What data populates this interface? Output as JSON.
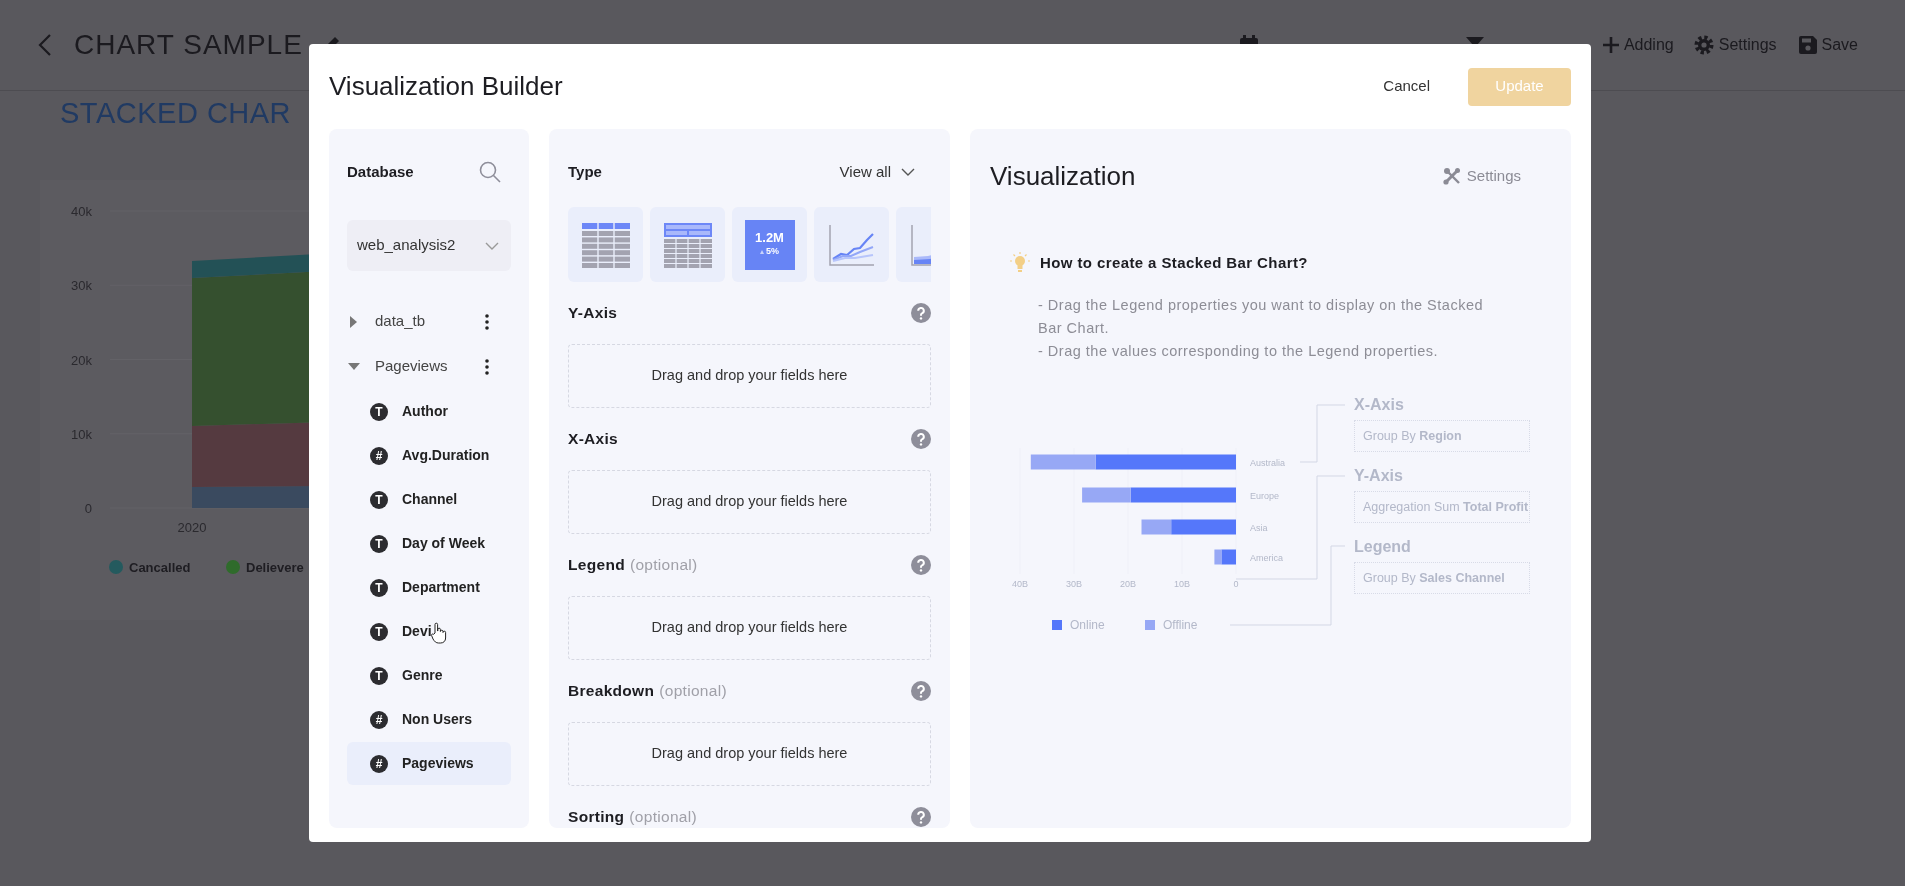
{
  "page": {
    "title": "CHART SAMPLE",
    "subtitle": "STACKED CHAR",
    "toolbar": [
      {
        "kind": "calendar"
      },
      {
        "kind": "filter"
      },
      {
        "kind": "add",
        "label": "Adding"
      },
      {
        "kind": "settings",
        "label": "Settings"
      },
      {
        "kind": "save",
        "label": "Save"
      }
    ],
    "chart": {
      "y_labels": [
        "40k",
        "30k",
        "20k",
        "10k",
        "0"
      ],
      "x_labels": [
        "2020"
      ],
      "legend": [
        {
          "label": "Cancalled",
          "color": "#245a5e"
        },
        {
          "label": "Delievere",
          "color": "#2f6b2b"
        }
      ]
    }
  },
  "modal": {
    "title": "Visualization Builder",
    "buttons": [
      {
        "label": "Cancel",
        "kind": "text",
        "disabled": false
      },
      {
        "label": "Update",
        "kind": "primary",
        "disabled": true
      }
    ]
  },
  "database": {
    "title": "Database",
    "selected_db": "web_analysis2",
    "tables": [
      {
        "label": "data_tb",
        "expanded": false
      },
      {
        "label": "Pageviews",
        "expanded": true,
        "children": [
          {
            "label": "Author",
            "glyph": "T",
            "selected": false
          },
          {
            "label": "Avg.Duration",
            "glyph": "#",
            "selected": false
          },
          {
            "label": "Channel",
            "glyph": "T",
            "selected": false
          },
          {
            "label": "Day of Week",
            "glyph": "T",
            "selected": false
          },
          {
            "label": "Department",
            "glyph": "T",
            "selected": false
          },
          {
            "label": "Devi",
            "glyph": "T",
            "selected": false
          },
          {
            "label": "Genre",
            "glyph": "T",
            "selected": false
          },
          {
            "label": "Non Users",
            "glyph": "#",
            "selected": false
          },
          {
            "label": "Pageviews",
            "glyph": "#",
            "selected": true
          }
        ]
      }
    ]
  },
  "builder": {
    "title": "Type",
    "view_all": "View all",
    "chart_types": [
      {
        "kind": "table"
      },
      {
        "kind": "pivot"
      },
      {
        "kind": "kpi",
        "value": "1.2M",
        "change": "5%"
      },
      {
        "kind": "line"
      },
      {
        "kind": "area"
      }
    ],
    "sections": [
      {
        "label": "Y-Axis",
        "drop_text": "Drag and drop your fields here"
      },
      {
        "label": "X-Axis",
        "drop_text": "Drag and drop your fields here"
      },
      {
        "label": "Legend",
        "note": "(optional)",
        "drop_text": "Drag and drop your fields here"
      },
      {
        "label": "Breakdown",
        "note": "(optional)",
        "drop_text": "Drag and drop your fields here"
      },
      {
        "label": "Sorting",
        "note": "(optional)"
      }
    ]
  },
  "visualization": {
    "title": "Visualization",
    "settings": "Settings",
    "help": {
      "heading": "How to create a Stacked Bar Chart?",
      "steps": [
        "- Drag the Legend properties you want to display on the Stacked Bar Chart.",
        "- Drag the values corresponding to the Legend properties."
      ]
    },
    "example": {
      "chart_data": {
        "type": "bar",
        "orientation": "horizontal",
        "stacked": true,
        "xlim": [
          40,
          0
        ],
        "legend": true,
        "categories": [
          "Australia",
          "Europe",
          "Asia",
          "America"
        ],
        "series": [
          {
            "name": "Online",
            "color": "#5577fa",
            "values": [
              26,
              19.5,
              12,
              2.7
            ]
          },
          {
            "name": "Offline",
            "color": "#97a8f5",
            "values": [
              12,
              9,
              5.5,
              1.3
            ]
          }
        ],
        "xticks": [
          {
            "value": 40,
            "label": "40B"
          },
          {
            "value": 30,
            "label": "30B"
          },
          {
            "value": 20,
            "label": "20B"
          },
          {
            "value": 10,
            "label": "10B"
          },
          {
            "value": 0,
            "label": "0"
          }
        ]
      },
      "guide": [
        {
          "title": "X-Axis",
          "text": "Group By **Region**"
        },
        {
          "title": "Y-Axis",
          "text": "Aggregation Sum **Total Profit**"
        },
        {
          "title": "Legend",
          "text": "Group By **Sales Channel**"
        }
      ]
    }
  }
}
